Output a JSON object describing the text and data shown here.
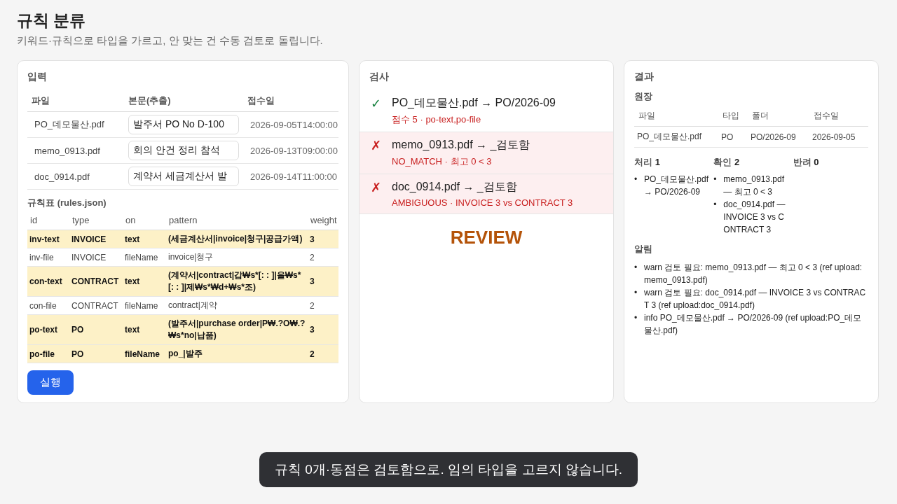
{
  "header": {
    "title": "규칙 분류",
    "subtitle": "키워드·규칙으로 타입을 가르고, 안 맞는 건 수동 검토로 돌립니다."
  },
  "input": {
    "title": "입력",
    "columns": [
      "파일",
      "본문(추출)",
      "접수일"
    ],
    "rows": [
      {
        "file": "PO_데모물산.pdf",
        "body": "발주서 PO No D-100",
        "date": "2026-09-05T14:00:00"
      },
      {
        "file": "memo_0913.pdf",
        "body": "회의 안건 정리 참석",
        "date": "2026-09-13T09:00:00"
      },
      {
        "file": "doc_0914.pdf",
        "body": "계약서 세금계산서 발",
        "date": "2026-09-14T11:00:00"
      }
    ],
    "rules_title": "규칙표",
    "rules_file": "(rules.json)",
    "rules_columns": [
      "id",
      "type",
      "on",
      "pattern",
      "weight"
    ],
    "rules": [
      {
        "id": "inv-text",
        "type": "INVOICE",
        "on": "text",
        "pattern": "(세금계산서|invoice|청구|공급가액)",
        "weight": "3",
        "highlighted": true
      },
      {
        "id": "inv-file",
        "type": "INVOICE",
        "on": "fileName",
        "pattern": "invoice|청구",
        "weight": "2",
        "highlighted": false
      },
      {
        "id": "con-text",
        "type": "CONTRACT",
        "on": "text",
        "pattern": "(계약서|contract|갑₩s*[: : ]|을₩s*[: : ]|제₩s*₩d+₩s*조)",
        "weight": "3",
        "highlighted": true
      },
      {
        "id": "con-file",
        "type": "CONTRACT",
        "on": "fileName",
        "pattern": "contract|계약",
        "weight": "2",
        "highlighted": false
      },
      {
        "id": "po-text",
        "type": "PO",
        "on": "text",
        "pattern": "(발주서|purchase order|P₩.?O₩.?₩s*no|납품)",
        "weight": "3",
        "highlighted": true
      },
      {
        "id": "po-file",
        "type": "PO",
        "on": "fileName",
        "pattern": "po_|발주",
        "weight": "2",
        "highlighted": true
      }
    ],
    "run_button": "실행"
  },
  "check": {
    "title": "검사",
    "items": [
      {
        "ok": true,
        "mark": "✓",
        "line": "PO_데모물산.pdf → PO/2026-09",
        "detail": "점수 5 · po-text,po-file"
      },
      {
        "ok": false,
        "mark": "✗",
        "line": "memo_0913.pdf → _검토함",
        "detail": "NO_MATCH · 최고 0 < 3"
      },
      {
        "ok": false,
        "mark": "✗",
        "line": "doc_0914.pdf → _검토함",
        "detail": "AMBIGUOUS · INVOICE 3 vs CONTRACT 3"
      }
    ],
    "verdict": "REVIEW"
  },
  "result": {
    "title": "결과",
    "ledger_title": "원장",
    "ledger_columns": [
      "파일",
      "타입",
      "폴더",
      "접수일"
    ],
    "ledger_rows": [
      [
        "PO_데모물산.pdf",
        "PO",
        "PO/2026-09",
        "2026-09-05"
      ]
    ],
    "groups": [
      {
        "label": "처리",
        "count": "1",
        "items": [
          "PO_데모물산.pdf → PO/2026-09"
        ]
      },
      {
        "label": "확인",
        "count": "2",
        "items": [
          "memo_0913.pdf — 최고 0 < 3",
          "doc_0914.pdf — INVOICE 3 vs CONTRACT 3"
        ]
      },
      {
        "label": "반려",
        "count": "0"
      }
    ],
    "bullet": "•",
    "alerts_title": "알림",
    "alerts": [
      "warn 검토 필요: memo_0913.pdf — 최고 0 < 3 (ref upload:memo_0913.pdf)",
      "warn 검토 필요: doc_0914.pdf — INVOICE 3 vs CONTRACT 3 (ref upload:doc_0914.pdf)",
      "info PO_데모물산.pdf → PO/2026-09 (ref upload:PO_데모물산.pdf)"
    ]
  },
  "toast": "규칙 0개·동점은 검토함으로. 임의 타입을 고르지 않습니다."
}
